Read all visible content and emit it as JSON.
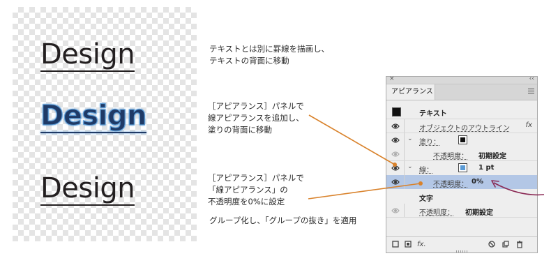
{
  "canvas": {
    "samples": [
      {
        "text": "Design"
      },
      {
        "text": "Design"
      },
      {
        "text": "Design"
      }
    ]
  },
  "notes": {
    "n1": "テキストとは別に罫線を描画し、\nテキストの背面に移動",
    "n2": "［アピアランス］パネルで\n線アピアランスを追加し、\n塗りの背面に移動",
    "n3": "［アピアランス］パネルで\n「線アピアランス」の\n不透明度を0%に設定",
    "n4": "グループ化し、「グループの抜き」を適用"
  },
  "panel": {
    "close": "×",
    "collapse": "‹‹",
    "tab": "アピアランス",
    "rows": {
      "header": "テキスト",
      "outline": "オブジェクトのアウトライン",
      "fill_label": "塗り：",
      "fill_opacity_label": "不透明度：",
      "fill_opacity_value": "初期設定",
      "stroke_label": "線：",
      "stroke_weight": "1 pt",
      "stroke_opacity_label": "不透明度：",
      "stroke_opacity_value": "0%",
      "char_label": "文字",
      "char_opacity_label": "不透明度：",
      "char_opacity_value": "初期設定"
    },
    "fx_label": "fx",
    "bottom_fx": "fx."
  },
  "colors": {
    "accent_arrow": "#d9822b",
    "purple_arrow": "#8b2a55",
    "selected_row": "#b3c7e6",
    "stroke_blue": "#5b9bd5"
  }
}
